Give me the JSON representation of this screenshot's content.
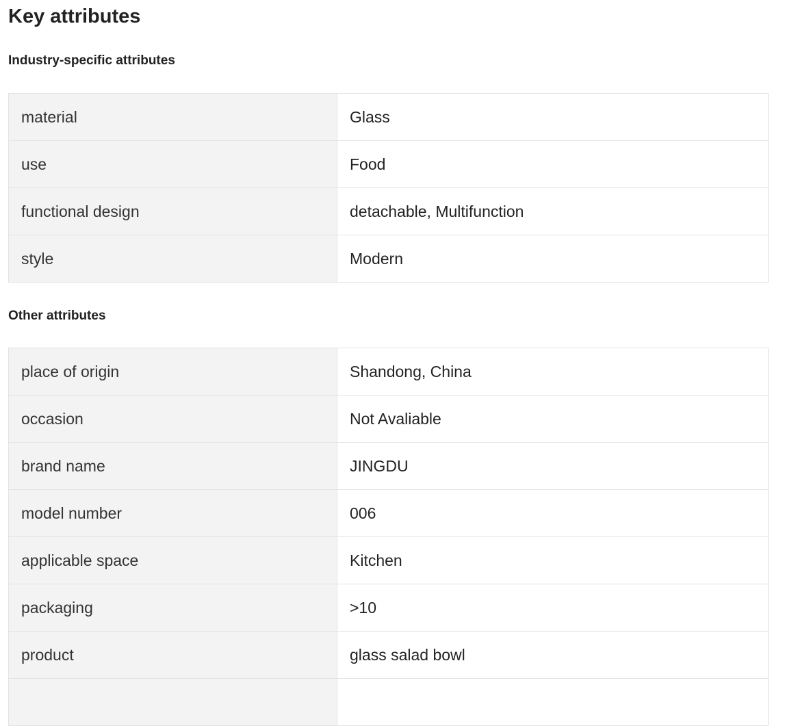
{
  "page_title": "Key attributes",
  "industry_section": {
    "title": "Industry-specific attributes",
    "rows": [
      {
        "name": "material",
        "value": "Glass"
      },
      {
        "name": "use",
        "value": "Food"
      },
      {
        "name": "functional design",
        "value": "detachable, Multifunction"
      },
      {
        "name": "style",
        "value": "Modern"
      }
    ]
  },
  "other_section": {
    "title": "Other attributes",
    "rows": [
      {
        "name": "place of origin",
        "value": "Shandong, China"
      },
      {
        "name": "occasion",
        "value": "Not Avaliable"
      },
      {
        "name": "brand name",
        "value": "JINGDU"
      },
      {
        "name": "model number",
        "value": "006"
      },
      {
        "name": "applicable space",
        "value": "Kitchen"
      },
      {
        "name": "packaging",
        "value": ">10"
      },
      {
        "name": "product",
        "value": "glass salad bowl"
      },
      {
        "name": "",
        "value": ""
      }
    ]
  },
  "colors": {
    "name_cell_bg": "#f3f3f3",
    "border": "#e3e3e3",
    "text": "#222222"
  }
}
